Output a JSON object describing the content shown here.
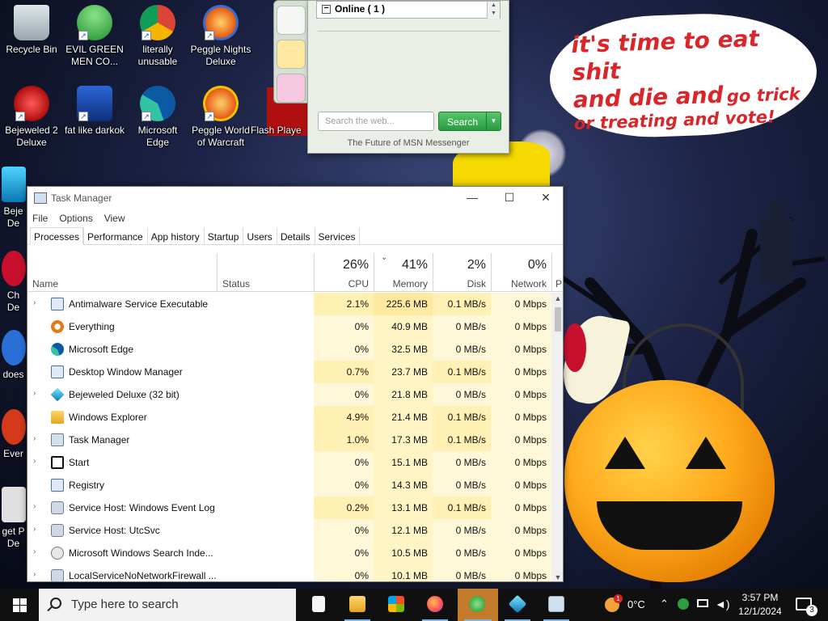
{
  "wallpaper": {
    "speech_line1": "it's time to eat shit",
    "speech_line2a": "and die and",
    "speech_line2b": "go trick",
    "speech_line3": "or treating and vote!"
  },
  "desktop_icons": [
    {
      "label": "Recycle Bin"
    },
    {
      "label": "EVIL GREEN MEN CO..."
    },
    {
      "label": "literally unusable"
    },
    {
      "label": "Peggle Nights Deluxe"
    },
    {
      "label": "Bejeweled 2 Deluxe"
    },
    {
      "label": "fat like darkok"
    },
    {
      "label": "Microsoft Edge"
    },
    {
      "label": "Peggle World of Warcraft"
    },
    {
      "label": "Flash Playe"
    },
    {
      "label": "Beje De"
    },
    {
      "label": "Ch De"
    },
    {
      "label": "does"
    },
    {
      "label": "Ever"
    },
    {
      "label": "get P De"
    }
  ],
  "messenger": {
    "group_label": "Online ( 1 )",
    "search_placeholder": "Search the web...",
    "search_button": "Search",
    "footer": "The Future of MSN Messenger"
  },
  "task_manager": {
    "title": "Task Manager",
    "menu": [
      "File",
      "Options",
      "View"
    ],
    "tabs": [
      "Processes",
      "Performance",
      "App history",
      "Startup",
      "Users",
      "Details",
      "Services"
    ],
    "active_tab": "Processes",
    "columns": {
      "name": "Name",
      "status": "Status",
      "cpu_pct": "26%",
      "cpu": "CPU",
      "mem_pct": "41%",
      "mem": "Memory",
      "disk_pct": "2%",
      "disk": "Disk",
      "net_pct": "0%",
      "net": "Network",
      "power": "P"
    },
    "processes": [
      {
        "name": "Antimalware Service Executable",
        "expand": true,
        "cpu": "2.1%",
        "mem": "225.6 MB",
        "disk": "0.1 MB/s",
        "net": "0 Mbps",
        "icon": "monitor-icon"
      },
      {
        "name": "Everything",
        "expand": false,
        "cpu": "0%",
        "mem": "40.9 MB",
        "disk": "0 MB/s",
        "net": "0 Mbps",
        "icon": "magnifier-icon"
      },
      {
        "name": "Microsoft Edge",
        "expand": false,
        "cpu": "0%",
        "mem": "32.5 MB",
        "disk": "0 MB/s",
        "net": "0 Mbps",
        "icon": "edge-icon"
      },
      {
        "name": "Desktop Window Manager",
        "expand": false,
        "cpu": "0.7%",
        "mem": "23.7 MB",
        "disk": "0.1 MB/s",
        "net": "0 Mbps",
        "icon": "monitor-icon"
      },
      {
        "name": "Bejeweled Deluxe (32 bit)",
        "expand": true,
        "cpu": "0%",
        "mem": "21.8 MB",
        "disk": "0 MB/s",
        "net": "0 Mbps",
        "icon": "gem-icon"
      },
      {
        "name": "Windows Explorer",
        "expand": false,
        "cpu": "4.9%",
        "mem": "21.4 MB",
        "disk": "0.1 MB/s",
        "net": "0 Mbps",
        "icon": "folder-icon"
      },
      {
        "name": "Task Manager",
        "expand": true,
        "cpu": "1.0%",
        "mem": "17.3 MB",
        "disk": "0.1 MB/s",
        "net": "0 Mbps",
        "icon": "task-manager-icon"
      },
      {
        "name": "Start",
        "expand": true,
        "cpu": "0%",
        "mem": "15.1 MB",
        "disk": "0 MB/s",
        "net": "0 Mbps",
        "icon": "start-icon"
      },
      {
        "name": "Registry",
        "expand": false,
        "cpu": "0%",
        "mem": "14.3 MB",
        "disk": "0 MB/s",
        "net": "0 Mbps",
        "icon": "monitor-icon"
      },
      {
        "name": "Service Host: Windows Event Log",
        "expand": true,
        "cpu": "0.2%",
        "mem": "13.1 MB",
        "disk": "0.1 MB/s",
        "net": "0 Mbps",
        "icon": "gear-icon"
      },
      {
        "name": "Service Host: UtcSvc",
        "expand": true,
        "cpu": "0%",
        "mem": "12.1 MB",
        "disk": "0 MB/s",
        "net": "0 Mbps",
        "icon": "gear-icon"
      },
      {
        "name": "Microsoft Windows Search Inde...",
        "expand": true,
        "cpu": "0%",
        "mem": "10.5 MB",
        "disk": "0 MB/s",
        "net": "0 Mbps",
        "icon": "search-indexer-icon"
      },
      {
        "name": "LocalServiceNoNetworkFirewall ...",
        "expand": true,
        "cpu": "0%",
        "mem": "10.1 MB",
        "disk": "0 MB/s",
        "net": "0 Mbps",
        "icon": "gear-icon"
      }
    ]
  },
  "taskbar": {
    "search_placeholder": "Type here to search",
    "temperature": "0°C",
    "time": "3:57 PM",
    "date": "12/1/2024",
    "notification_count": "3",
    "weather_badge": "1"
  },
  "colors": {
    "cpu_heat": "#fff4c4",
    "heat_strong": "#ffe9a1",
    "heat_light": "#fff8d8",
    "accent": "#0078d7"
  }
}
